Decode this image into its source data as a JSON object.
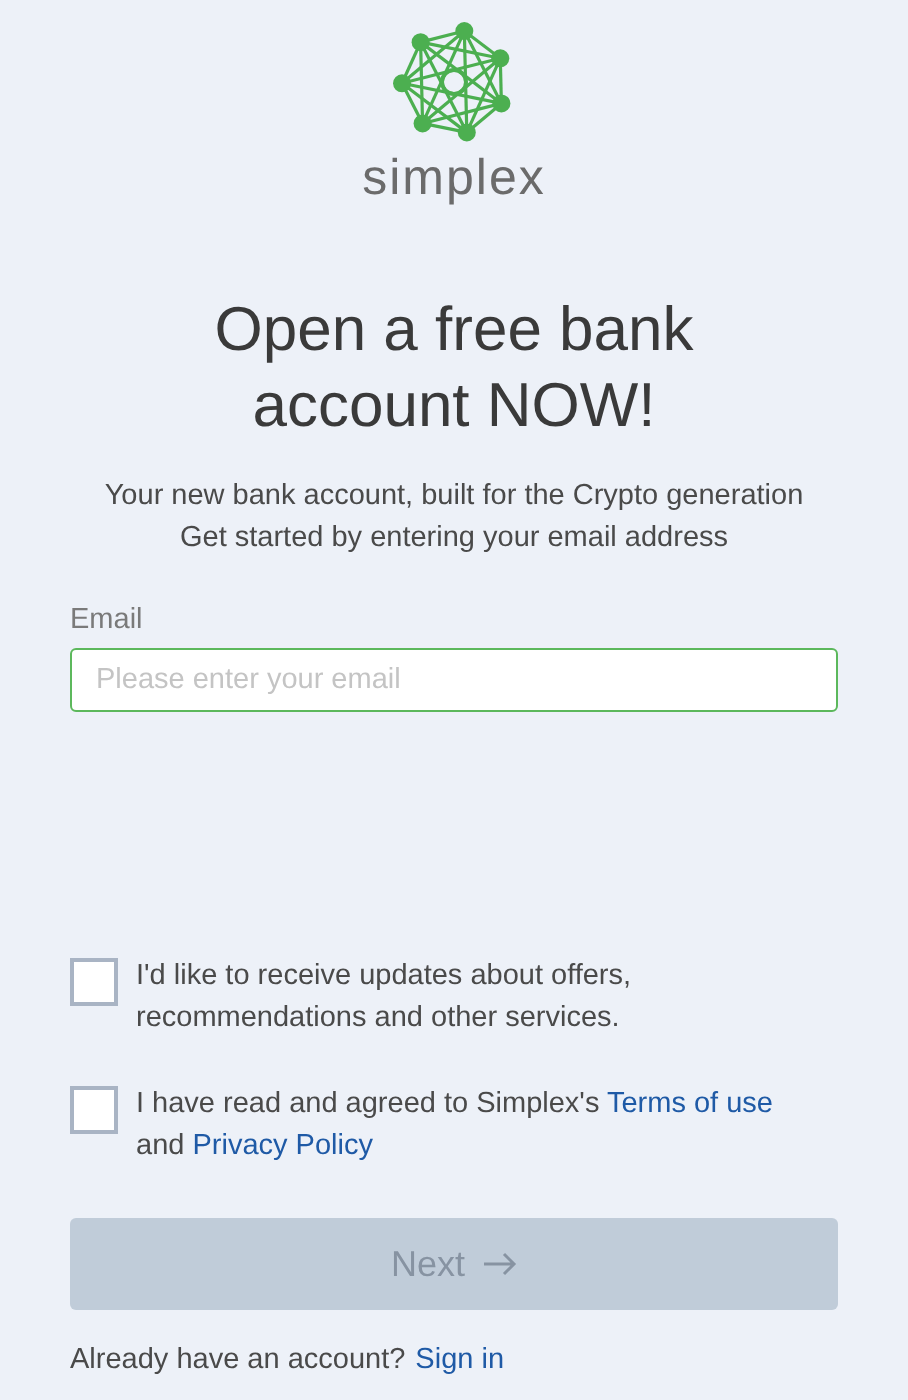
{
  "brand": {
    "name": "simplex"
  },
  "heading": "Open a free bank account NOW!",
  "subtitle": [
    "Your new bank account, built for the Crypto generation",
    "Get started by entering your email address"
  ],
  "email": {
    "label": "Email",
    "placeholder": "Please enter your email",
    "focused": true
  },
  "consents": [
    {
      "checked": false,
      "parts": [
        {
          "kind": "text",
          "text": "I'd like to receive updates about offers, recommendations and other services."
        }
      ]
    },
    {
      "checked": false,
      "parts": [
        {
          "kind": "text",
          "text": "I have read and agreed to Simplex's "
        },
        {
          "kind": "link",
          "text": "Terms of use"
        },
        {
          "kind": "text",
          "text": " and "
        },
        {
          "kind": "link",
          "text": "Privacy Policy"
        }
      ]
    }
  ],
  "next_button": {
    "label": "Next",
    "disabled": true
  },
  "footer": {
    "text": "Already have an account?",
    "link": "Sign in"
  }
}
